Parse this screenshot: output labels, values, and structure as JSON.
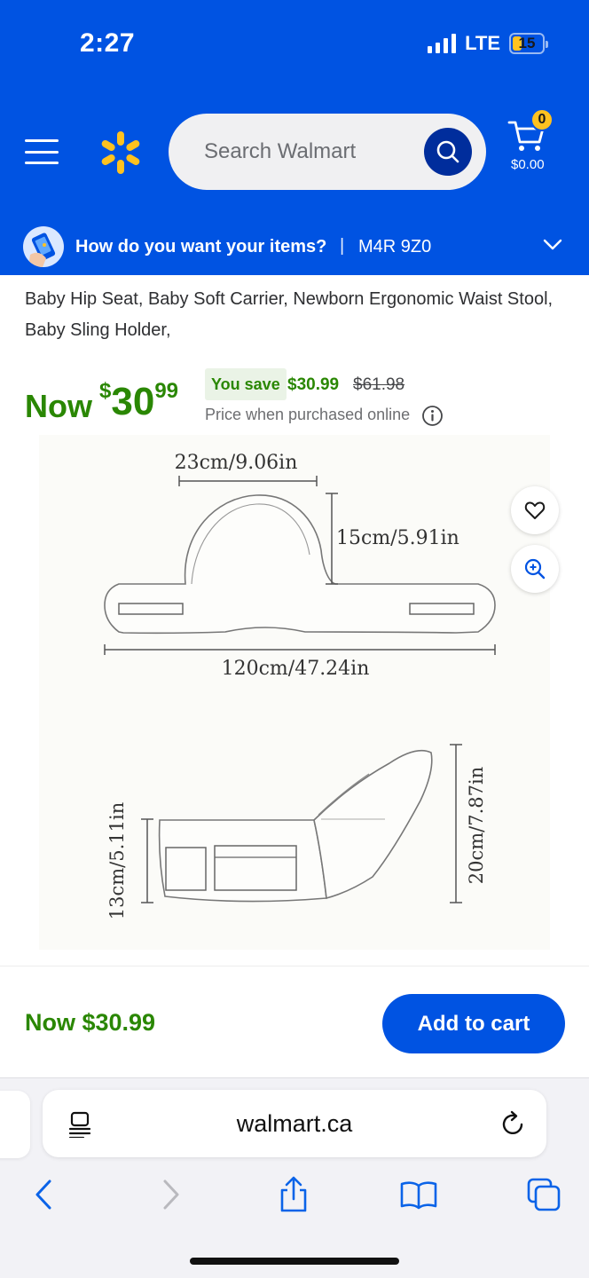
{
  "status_bar": {
    "time": "2:27",
    "network": "LTE",
    "battery": "15"
  },
  "header": {
    "search": {
      "placeholder": "Search Walmart"
    },
    "cart": {
      "count": "0",
      "total": "$0.00"
    },
    "delivery": {
      "prompt": "How do you want your items?",
      "separator": "|",
      "postal_code": "M4R 9Z0"
    }
  },
  "product": {
    "title": "Baby Hip Seat, Baby Soft Carrier, Newborn Ergonomic Waist Stool, Baby Sling Holder,",
    "price": {
      "now_label": "Now",
      "currency": "$",
      "whole": "30",
      "cents": "99"
    },
    "savings": {
      "label": "You save",
      "amount": "$30.99",
      "was_price": "$61.98"
    },
    "online_note": "Price when purchased online",
    "image_labels": {
      "width_top": "23cm/9.06in",
      "height_top": "15cm/5.91in",
      "length_total": "120cm/47.24in",
      "height_seat": "13cm/5.11in",
      "height_side": "20cm/7.87in"
    }
  },
  "sticky_bar": {
    "price_text": "Now $30.99",
    "add_to_cart": "Add to cart"
  },
  "browser": {
    "url": "walmart.ca"
  },
  "colors": {
    "walmart_blue": "#0053e2",
    "spark_yellow": "#ffc220",
    "price_green": "#2a8703"
  }
}
